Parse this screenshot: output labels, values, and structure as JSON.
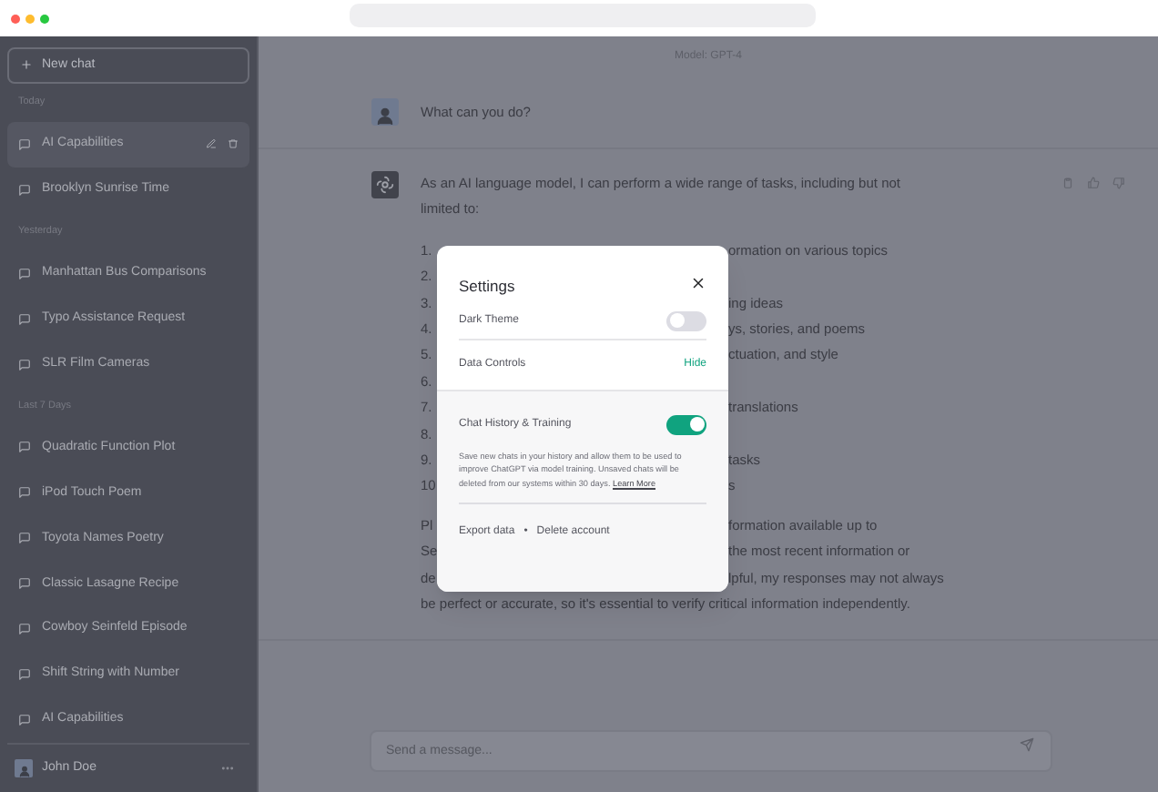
{
  "sidebar": {
    "new_chat": "New chat",
    "sections": [
      {
        "label": "Today",
        "items": [
          {
            "title": "AI Capabilities",
            "selected": true
          },
          {
            "title": "Brooklyn Sunrise Time",
            "selected": false
          }
        ]
      },
      {
        "label": "Yesterday",
        "items": [
          {
            "title": "Manhattan Bus Comparisons",
            "selected": false
          },
          {
            "title": "Typo Assistance Request",
            "selected": false
          },
          {
            "title": "SLR Film Cameras",
            "selected": false
          }
        ]
      },
      {
        "label": "Last 7 Days",
        "items": [
          {
            "title": "Quadratic Function Plot",
            "selected": false
          },
          {
            "title": "iPod Touch Poem",
            "selected": false
          },
          {
            "title": "Toyota Names Poetry",
            "selected": false
          },
          {
            "title": "Classic Lasagne Recipe",
            "selected": false
          },
          {
            "title": "Cowboy Seinfeld Episode",
            "selected": false
          },
          {
            "title": "Shift String with Number",
            "selected": false
          },
          {
            "title": "AI Capabilities",
            "selected": false
          }
        ]
      }
    ],
    "user": {
      "name": "John Doe"
    }
  },
  "main": {
    "model_label": "Model: GPT-4",
    "messages": [
      {
        "kind": "user",
        "text": "What can you do?"
      },
      {
        "kind": "assistant",
        "intro": "As an AI language model, I can perform a wide range of tasks, including but not limited to:",
        "list": [
          {
            "number": "1.",
            "text": "ormation on various topics"
          },
          {
            "number": "2."
          },
          {
            "number": "3.",
            "text": "ing ideas"
          },
          {
            "number": "4.",
            "text": "ys, stories, and poems"
          },
          {
            "number": "5.",
            "text": "ctuation, and style"
          },
          {
            "number": "6."
          },
          {
            "number": "7.",
            "text": "translations"
          },
          {
            "number": "8."
          },
          {
            "number": "9.",
            "text": "tasks"
          },
          {
            "number": "10",
            "text": "s"
          }
        ],
        "paragraph_lines": [
          {
            "start": "Pl",
            "end": "formation available up to"
          },
          {
            "start": "Se",
            "end": "the most recent information or"
          },
          {
            "start": "de",
            "end": "lpful, my responses may not always"
          },
          {
            "start": "be perfect or accurate, so it's essential to verify critical information independently."
          }
        ]
      }
    ],
    "composer": {
      "placeholder": "Send a message..."
    }
  },
  "settings_dialog": {
    "title": "Settings",
    "dark_theme": {
      "label": "Dark Theme",
      "on": false
    },
    "data_controls": {
      "label": "Data Controls",
      "action": "Hide"
    },
    "chat_history": {
      "label": "Chat History & Training",
      "on": true
    },
    "description": "Save new chats in your history and allow them to be used to improve ChatGPT via model training. Unsaved chats will be deleted from our systems within 30 days.",
    "learn_more": "Learn More",
    "footer": {
      "export": "Export data",
      "separator": "•",
      "delete": "Delete account"
    }
  }
}
